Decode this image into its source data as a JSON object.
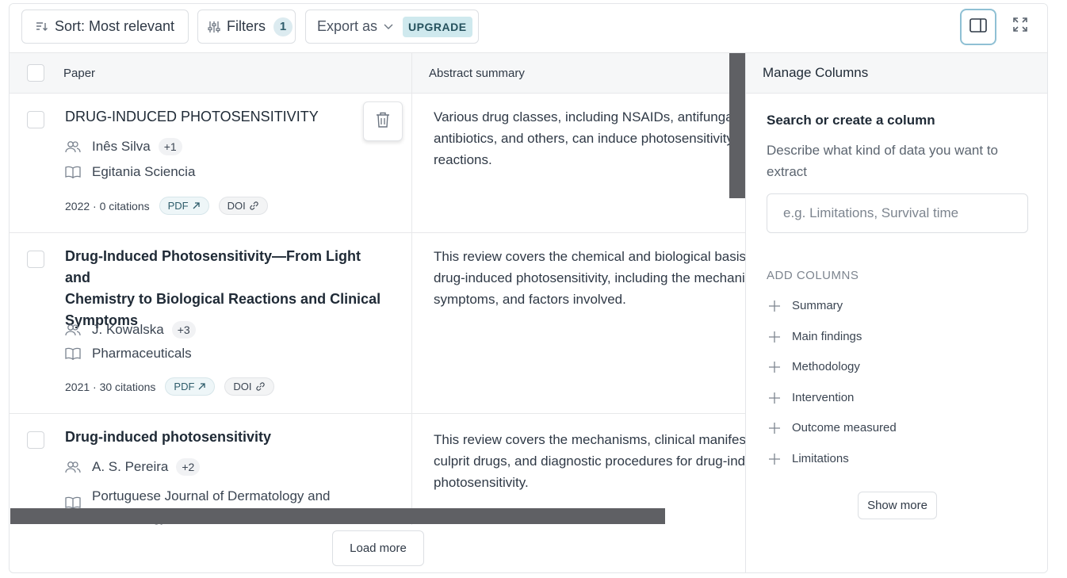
{
  "toolbar": {
    "sort_label": "Sort: Most relevant",
    "filters_label": "Filters",
    "filters_count": "1",
    "export_label": "Export as",
    "upgrade_badge": "UPGRADE"
  },
  "table": {
    "headers": {
      "paper": "Paper",
      "abstract": "Abstract summary"
    },
    "rows": [
      {
        "title": "DRUG-INDUCED PHOTOSENSITIVITY",
        "author": "Inês Silva",
        "more_authors": "+1",
        "journal": "Egitania Sciencia",
        "stats": "2022 · 0 citations",
        "pdf": "PDF",
        "doi": "DOI",
        "abstract_lines": [
          "Various drug classes, including NSAIDs, antifungals,",
          "antibiotics, and others, can induce photosensitivity",
          "reactions."
        ]
      },
      {
        "title_lines": [
          "Drug-Induced Photosensitivity—From Light and",
          "Chemistry to Biological Reactions and Clinical",
          "Symptoms"
        ],
        "author": "J. Kowalska",
        "more_authors": "+3",
        "journal": "Pharmaceuticals",
        "stats": "2021 · 30 citations",
        "pdf": "PDF",
        "doi": "DOI",
        "abstract_lines": [
          "This review covers the chemical and biological basis of",
          "drug-induced photosensitivity, including the mechanisms,",
          "symptoms, and factors involved."
        ]
      },
      {
        "title": "Drug-induced photosensitivity",
        "author": "A. S. Pereira",
        "more_authors": "+2",
        "journal_lines": [
          "Portuguese Journal of Dermatology and",
          "Venereology"
        ],
        "abstract_lines": [
          "This review covers the mechanisms, clinical manifestations,",
          "culprit drugs, and diagnostic procedures for drug-induced",
          "photosensitivity."
        ]
      }
    ],
    "load_more": "Load more"
  },
  "panel": {
    "title": "Manage Columns",
    "subtitle": "Search or create a column",
    "description": "Describe what kind of data you want to extract",
    "input_placeholder": "e.g. Limitations, Survival time",
    "add_columns_label": "ADD COLUMNS",
    "columns": [
      "Summary",
      "Main findings",
      "Methodology",
      "Intervention",
      "Outcome measured",
      "Limitations"
    ],
    "show_more": "Show more"
  },
  "icons": [
    "sort-icon",
    "filters-icon",
    "chevron-down-icon",
    "panel-toggle-icon",
    "expand-icon",
    "users-icon",
    "book-icon",
    "external-link-icon",
    "link-icon",
    "trash-icon",
    "plus-icon"
  ]
}
